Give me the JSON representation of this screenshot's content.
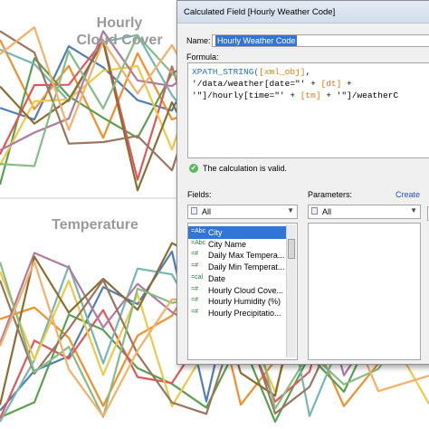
{
  "background": {
    "panels": [
      {
        "title": "Hourly\nCloud Cover"
      },
      {
        "title": "Temperature"
      }
    ],
    "series_colors": [
      "#4e7fb5",
      "#f28e2b",
      "#59a14f",
      "#e15759",
      "#76b7b2",
      "#edc948",
      "#b07aa1",
      "#8c6d31",
      "#9c755f",
      "#86bc86",
      "#f5b066",
      "#5aa0d6"
    ]
  },
  "dialog": {
    "title": "Calculated Field [Hourly Weather Code]",
    "name_label": "Name:",
    "name_value": "Hourly Weather Code",
    "formula_label": "Formula:",
    "formula_lines": [
      [
        {
          "t": "XPATH_STRING(",
          "c": "fn"
        },
        {
          "t": "[xml_obj]",
          "c": "fld"
        },
        {
          "t": ",",
          "c": "str"
        }
      ],
      [
        {
          "t": "'/data/weather[date=\"' + ",
          "c": "str"
        },
        {
          "t": "[dt]",
          "c": "fld"
        },
        {
          "t": " +",
          "c": "str"
        }
      ],
      [
        {
          "t": "'\"]/hourly[time=\"' + ",
          "c": "str"
        },
        {
          "t": "[tm]",
          "c": "fld"
        },
        {
          "t": " + '\"]/weatherC",
          "c": "str"
        }
      ]
    ],
    "valid_icon": "check-circle-icon",
    "valid_text": "The calculation is valid.",
    "fields_label": "Fields:",
    "parameters_label": "Parameters:",
    "create_link": "Create",
    "fields_dropdown": "All",
    "params_dropdown": "All",
    "fields": [
      {
        "type": "=Abc",
        "name": "City",
        "selected": true
      },
      {
        "type": "=Abc",
        "name": "City Name",
        "selected": false
      },
      {
        "type": "=#",
        "name": "Daily Max Tempera...",
        "selected": false
      },
      {
        "type": "=#",
        "name": "Daily Min Temperat...",
        "selected": false
      },
      {
        "type": "=cal",
        "name": "Date",
        "selected": false
      },
      {
        "type": "=#",
        "name": "Hourly Cloud Cove...",
        "selected": false
      },
      {
        "type": "=#",
        "name": "Hourly Humidity (%)",
        "selected": false
      },
      {
        "type": "=#",
        "name": "Hourly Precipitatio...",
        "selected": false
      }
    ]
  }
}
